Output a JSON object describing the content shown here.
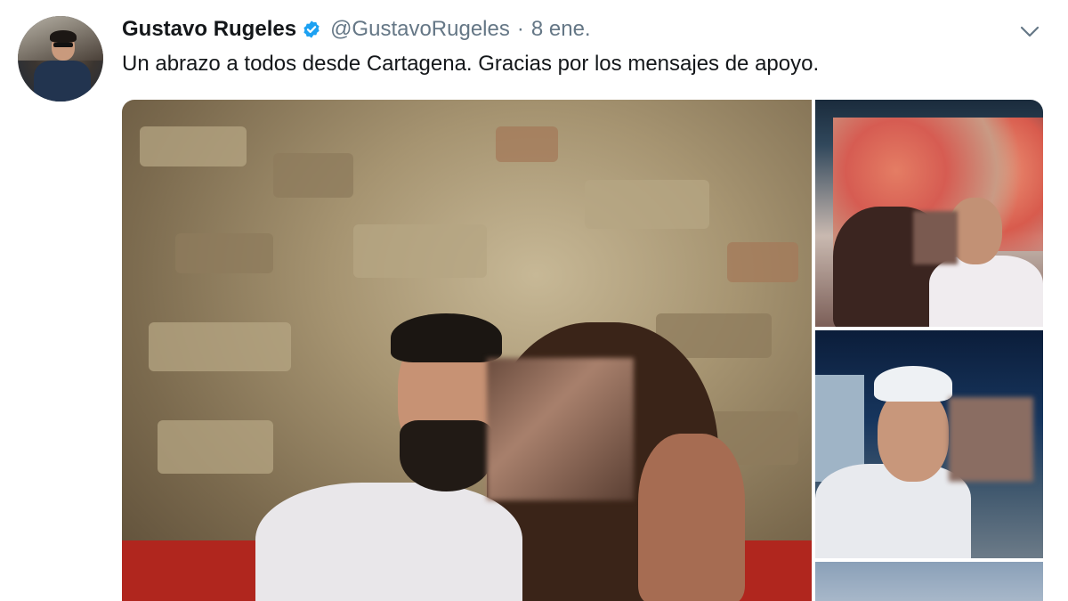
{
  "tweet": {
    "author_name": "Gustavo Rugeles",
    "author_handle": "@GustavoRugeles",
    "separator": "·",
    "date": "8 ene.",
    "text": "Un abrazo a todos desde Cartagena. Gracias por los mensajes de apoyo."
  },
  "icons": {
    "verified": "verified-badge-icon",
    "caret": "chevron-down-icon"
  },
  "colors": {
    "verified_blue": "#1da1f2",
    "name_text": "#14171a",
    "secondary_text": "#657786"
  }
}
